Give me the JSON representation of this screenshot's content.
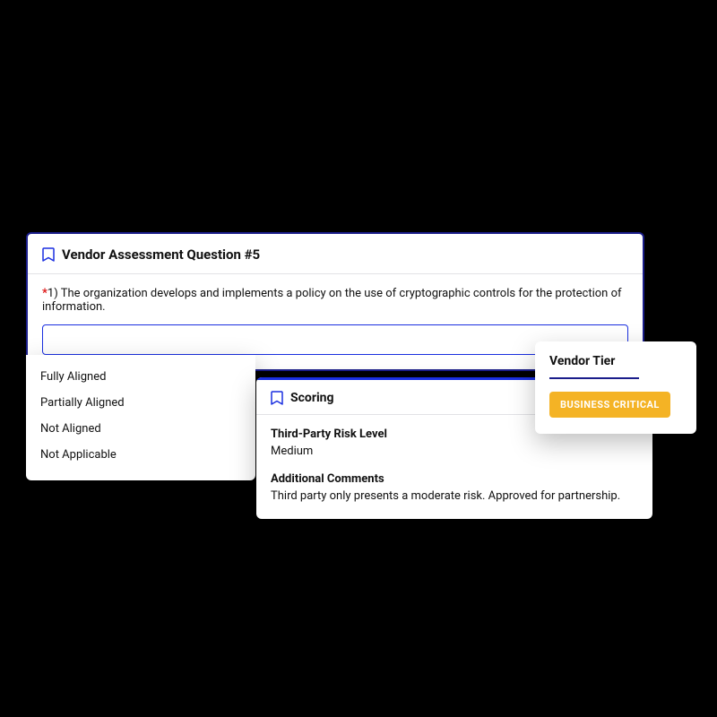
{
  "assessment": {
    "title": "Vendor Assessment Question #5",
    "question_number": "1)",
    "question_text": "The organization develops and implements a policy on the use of cryptographic controls for the protection of information."
  },
  "dropdown": {
    "options": [
      "Fully Aligned",
      "Partially Aligned",
      "Not Aligned",
      "Not Applicable"
    ]
  },
  "scoring": {
    "title": "Scoring",
    "risk_label": "Third-Party Risk Level",
    "risk_value": "Medium",
    "comments_label": "Additional Comments",
    "comments_value": "Third party only presents a moderate risk. Approved for partnership."
  },
  "tier": {
    "title": "Vendor Tier",
    "badge": "BUSINESS CRITICAL"
  }
}
